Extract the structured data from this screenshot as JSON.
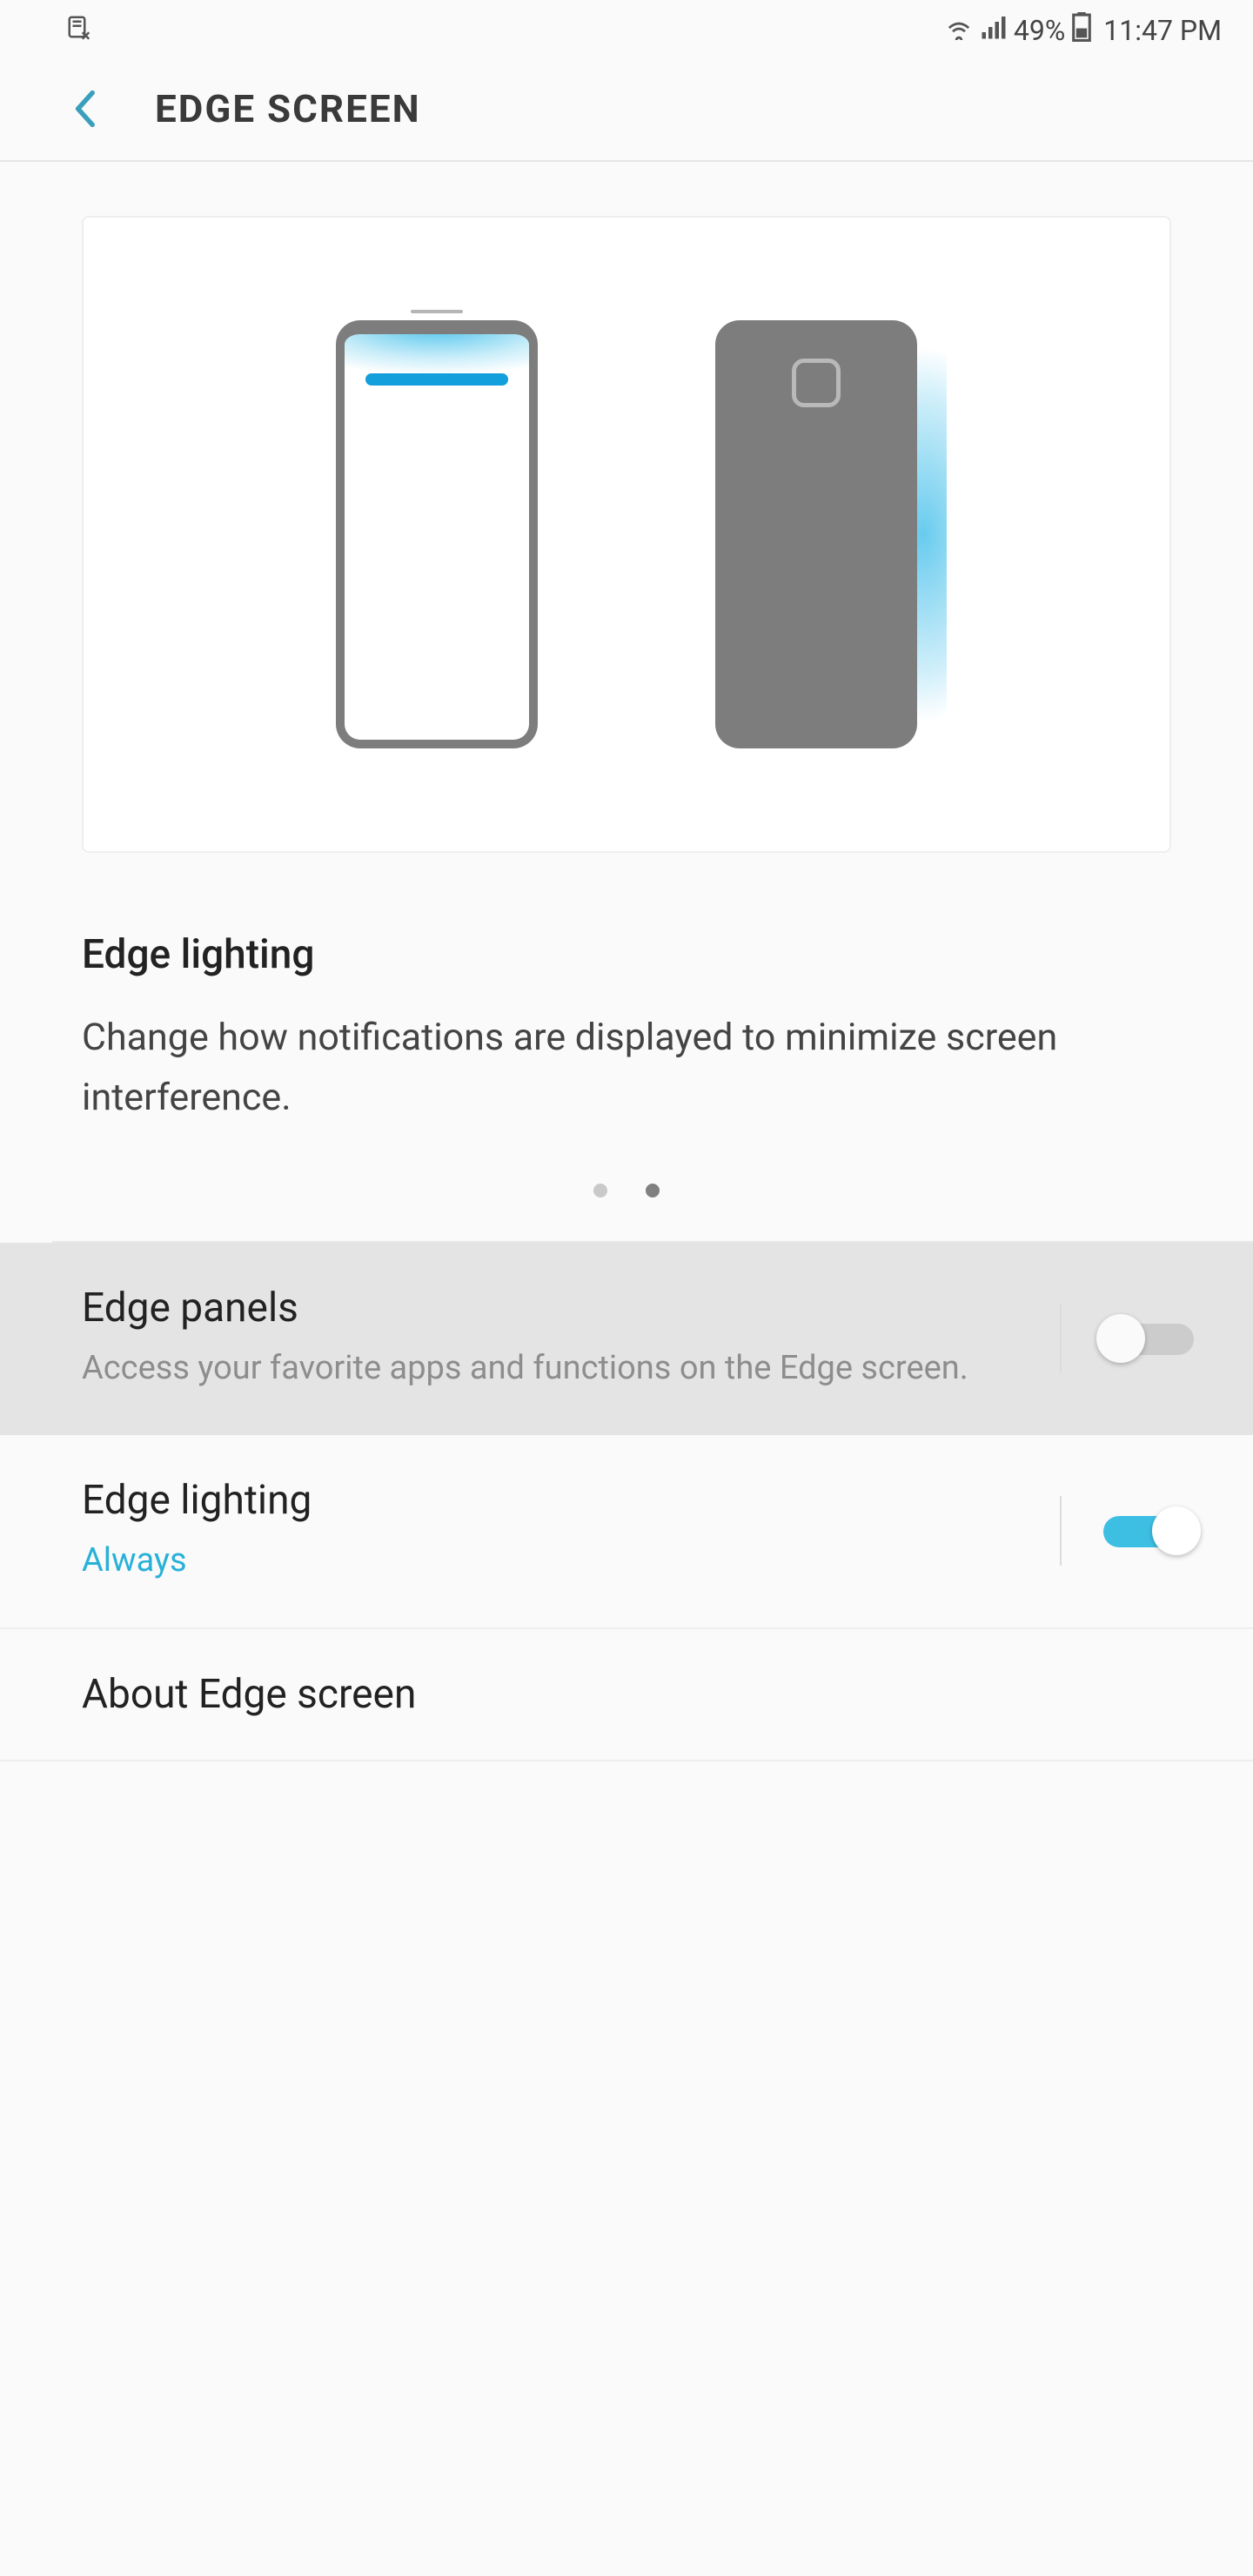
{
  "statusbar": {
    "battery_pct": "49%",
    "time": "11:47 PM"
  },
  "header": {
    "title": "EDGE SCREEN"
  },
  "preview": {
    "title": "Edge lighting",
    "description": "Change how notifications are displayed to minimize screen interference."
  },
  "pager": {
    "dot_count": 2,
    "active_index": 1
  },
  "settings": {
    "edge_panels": {
      "title": "Edge panels",
      "subtitle": "Access your favorite apps and functions on the Edge screen.",
      "enabled": false
    },
    "edge_lighting": {
      "title": "Edge lighting",
      "subtitle": "Always",
      "enabled": true
    },
    "about": {
      "title": "About Edge screen"
    }
  }
}
